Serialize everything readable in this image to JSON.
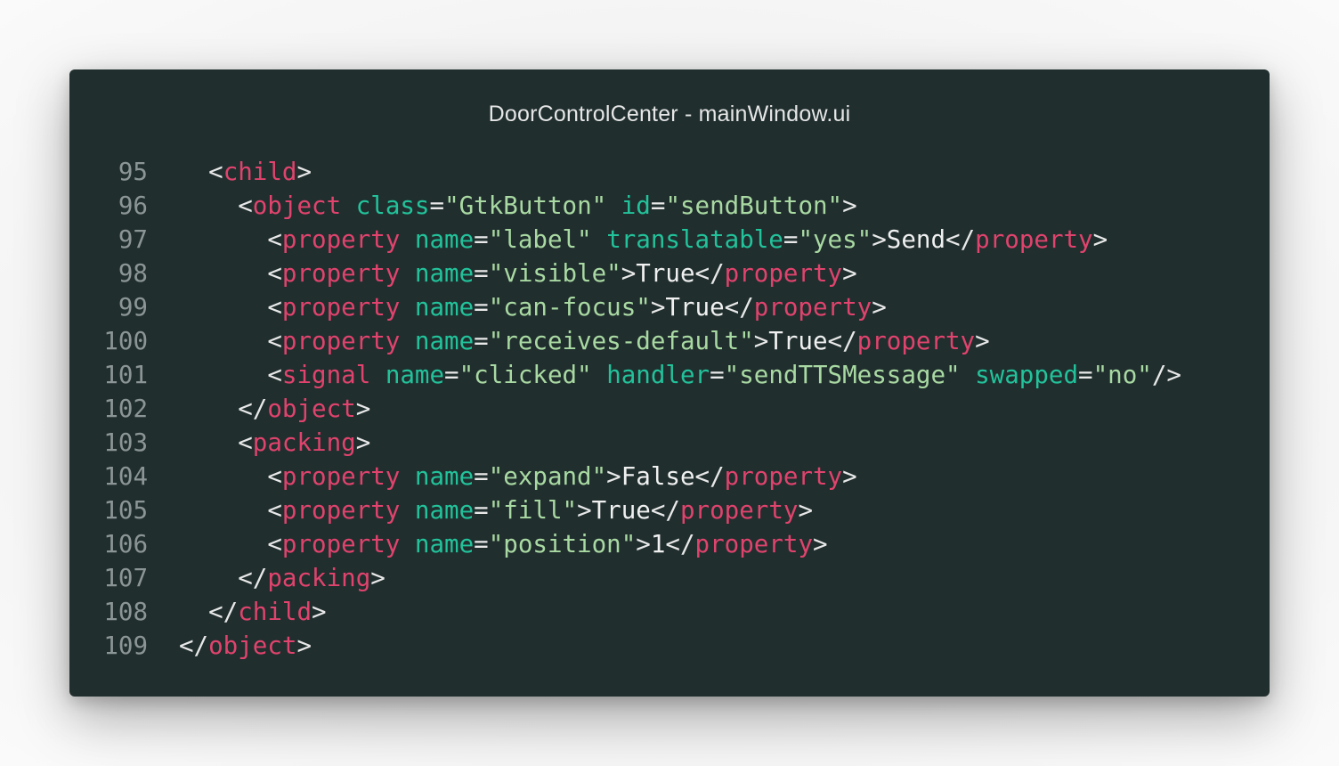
{
  "window": {
    "title": "DoorControlCenter - mainWindow.ui"
  },
  "code": {
    "lines": [
      {
        "num": "95",
        "indent": 1,
        "tokens": [
          {
            "k": "p",
            "v": "<"
          },
          {
            "k": "t",
            "v": "child"
          },
          {
            "k": "p",
            "v": ">"
          }
        ]
      },
      {
        "num": "96",
        "indent": 2,
        "tokens": [
          {
            "k": "p",
            "v": "<"
          },
          {
            "k": "t",
            "v": "object"
          },
          {
            "k": "p",
            "v": " "
          },
          {
            "k": "a",
            "v": "class"
          },
          {
            "k": "p",
            "v": "="
          },
          {
            "k": "s",
            "v": "\"GtkButton\""
          },
          {
            "k": "p",
            "v": " "
          },
          {
            "k": "a",
            "v": "id"
          },
          {
            "k": "p",
            "v": "="
          },
          {
            "k": "s",
            "v": "\"sendButton\""
          },
          {
            "k": "p",
            "v": ">"
          }
        ]
      },
      {
        "num": "97",
        "indent": 3,
        "tokens": [
          {
            "k": "p",
            "v": "<"
          },
          {
            "k": "t",
            "v": "property"
          },
          {
            "k": "p",
            "v": " "
          },
          {
            "k": "a",
            "v": "name"
          },
          {
            "k": "p",
            "v": "="
          },
          {
            "k": "s",
            "v": "\"label\""
          },
          {
            "k": "p",
            "v": " "
          },
          {
            "k": "a",
            "v": "translatable"
          },
          {
            "k": "p",
            "v": "="
          },
          {
            "k": "s",
            "v": "\"yes\""
          },
          {
            "k": "p",
            "v": ">"
          },
          {
            "k": "x",
            "v": "Send"
          },
          {
            "k": "p",
            "v": "</"
          },
          {
            "k": "t",
            "v": "property"
          },
          {
            "k": "p",
            "v": ">"
          }
        ]
      },
      {
        "num": "98",
        "indent": 3,
        "tokens": [
          {
            "k": "p",
            "v": "<"
          },
          {
            "k": "t",
            "v": "property"
          },
          {
            "k": "p",
            "v": " "
          },
          {
            "k": "a",
            "v": "name"
          },
          {
            "k": "p",
            "v": "="
          },
          {
            "k": "s",
            "v": "\"visible\""
          },
          {
            "k": "p",
            "v": ">"
          },
          {
            "k": "x",
            "v": "True"
          },
          {
            "k": "p",
            "v": "</"
          },
          {
            "k": "t",
            "v": "property"
          },
          {
            "k": "p",
            "v": ">"
          }
        ]
      },
      {
        "num": "99",
        "indent": 3,
        "tokens": [
          {
            "k": "p",
            "v": "<"
          },
          {
            "k": "t",
            "v": "property"
          },
          {
            "k": "p",
            "v": " "
          },
          {
            "k": "a",
            "v": "name"
          },
          {
            "k": "p",
            "v": "="
          },
          {
            "k": "s",
            "v": "\"can-focus\""
          },
          {
            "k": "p",
            "v": ">"
          },
          {
            "k": "x",
            "v": "True"
          },
          {
            "k": "p",
            "v": "</"
          },
          {
            "k": "t",
            "v": "property"
          },
          {
            "k": "p",
            "v": ">"
          }
        ]
      },
      {
        "num": "100",
        "indent": 3,
        "tokens": [
          {
            "k": "p",
            "v": "<"
          },
          {
            "k": "t",
            "v": "property"
          },
          {
            "k": "p",
            "v": " "
          },
          {
            "k": "a",
            "v": "name"
          },
          {
            "k": "p",
            "v": "="
          },
          {
            "k": "s",
            "v": "\"receives-default\""
          },
          {
            "k": "p",
            "v": ">"
          },
          {
            "k": "x",
            "v": "True"
          },
          {
            "k": "p",
            "v": "</"
          },
          {
            "k": "t",
            "v": "property"
          },
          {
            "k": "p",
            "v": ">"
          }
        ]
      },
      {
        "num": "101",
        "indent": 3,
        "tokens": [
          {
            "k": "p",
            "v": "<"
          },
          {
            "k": "t",
            "v": "signal"
          },
          {
            "k": "p",
            "v": " "
          },
          {
            "k": "a",
            "v": "name"
          },
          {
            "k": "p",
            "v": "="
          },
          {
            "k": "s",
            "v": "\"clicked\""
          },
          {
            "k": "p",
            "v": " "
          },
          {
            "k": "a",
            "v": "handler"
          },
          {
            "k": "p",
            "v": "="
          },
          {
            "k": "s",
            "v": "\"sendTTSMessage\""
          },
          {
            "k": "p",
            "v": " "
          },
          {
            "k": "a",
            "v": "swapped"
          },
          {
            "k": "p",
            "v": "="
          },
          {
            "k": "s",
            "v": "\"no\""
          },
          {
            "k": "p",
            "v": "/>"
          }
        ]
      },
      {
        "num": "102",
        "indent": 2,
        "tokens": [
          {
            "k": "p",
            "v": "</"
          },
          {
            "k": "t",
            "v": "object"
          },
          {
            "k": "p",
            "v": ">"
          }
        ]
      },
      {
        "num": "103",
        "indent": 2,
        "tokens": [
          {
            "k": "p",
            "v": "<"
          },
          {
            "k": "t",
            "v": "packing"
          },
          {
            "k": "p",
            "v": ">"
          }
        ]
      },
      {
        "num": "104",
        "indent": 3,
        "tokens": [
          {
            "k": "p",
            "v": "<"
          },
          {
            "k": "t",
            "v": "property"
          },
          {
            "k": "p",
            "v": " "
          },
          {
            "k": "a",
            "v": "name"
          },
          {
            "k": "p",
            "v": "="
          },
          {
            "k": "s",
            "v": "\"expand\""
          },
          {
            "k": "p",
            "v": ">"
          },
          {
            "k": "x",
            "v": "False"
          },
          {
            "k": "p",
            "v": "</"
          },
          {
            "k": "t",
            "v": "property"
          },
          {
            "k": "p",
            "v": ">"
          }
        ]
      },
      {
        "num": "105",
        "indent": 3,
        "tokens": [
          {
            "k": "p",
            "v": "<"
          },
          {
            "k": "t",
            "v": "property"
          },
          {
            "k": "p",
            "v": " "
          },
          {
            "k": "a",
            "v": "name"
          },
          {
            "k": "p",
            "v": "="
          },
          {
            "k": "s",
            "v": "\"fill\""
          },
          {
            "k": "p",
            "v": ">"
          },
          {
            "k": "x",
            "v": "True"
          },
          {
            "k": "p",
            "v": "</"
          },
          {
            "k": "t",
            "v": "property"
          },
          {
            "k": "p",
            "v": ">"
          }
        ]
      },
      {
        "num": "106",
        "indent": 3,
        "tokens": [
          {
            "k": "p",
            "v": "<"
          },
          {
            "k": "t",
            "v": "property"
          },
          {
            "k": "p",
            "v": " "
          },
          {
            "k": "a",
            "v": "name"
          },
          {
            "k": "p",
            "v": "="
          },
          {
            "k": "s",
            "v": "\"position\""
          },
          {
            "k": "p",
            "v": ">"
          },
          {
            "k": "x",
            "v": "1"
          },
          {
            "k": "p",
            "v": "</"
          },
          {
            "k": "t",
            "v": "property"
          },
          {
            "k": "p",
            "v": ">"
          }
        ]
      },
      {
        "num": "107",
        "indent": 2,
        "tokens": [
          {
            "k": "p",
            "v": "</"
          },
          {
            "k": "t",
            "v": "packing"
          },
          {
            "k": "p",
            "v": ">"
          }
        ]
      },
      {
        "num": "108",
        "indent": 1,
        "tokens": [
          {
            "k": "p",
            "v": "</"
          },
          {
            "k": "t",
            "v": "child"
          },
          {
            "k": "p",
            "v": ">"
          }
        ]
      },
      {
        "num": "109",
        "indent": 0,
        "tokens": [
          {
            "k": "p",
            "v": "</"
          },
          {
            "k": "t",
            "v": "object"
          },
          {
            "k": "p",
            "v": ">"
          }
        ]
      }
    ]
  },
  "colors": {
    "background": "#202e2e",
    "line_number": "#8c9596",
    "tag": "#e0436d",
    "attribute": "#22c29a",
    "string": "#a9d9a2",
    "punctuation": "#e8e8e8"
  }
}
